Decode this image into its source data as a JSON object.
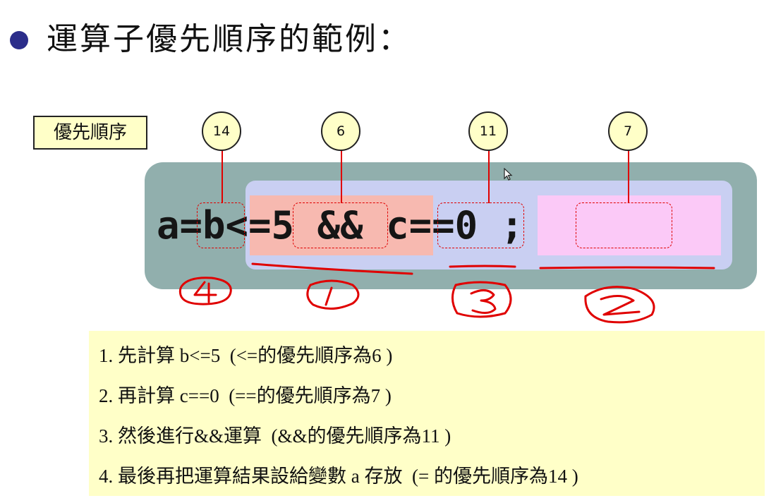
{
  "slide": {
    "title": "運算子優先順序的範例："
  },
  "legend": {
    "label": "優先順序"
  },
  "precedence_markers": [
    {
      "value": "14",
      "operator": "="
    },
    {
      "value": "6",
      "operator": "<="
    },
    {
      "value": "11",
      "operator": "&&"
    },
    {
      "value": "7",
      "operator": "=="
    }
  ],
  "expression": {
    "text": "a=b<=5 && c==0 ;"
  },
  "handwritten_order": [
    "4",
    "1",
    "3",
    "2"
  ],
  "explanation": {
    "line1": "1. 先計算 b<=5  (<=的優先順序為6 )",
    "line2": "2. 再計算 c==0  (==的優先順序為7 )",
    "line3": "3. 然後進行&&運算  (&&的優先順序為11 )",
    "line4": "4. 最後再把運算結果設給變數 a 存放  (= 的優先順序為14 )"
  },
  "colors": {
    "outer_panel": "#91afad",
    "inner_panel": "#c9cff2",
    "pink_highlight": "#f7b9b0",
    "magenta_highlight": "#fbc9f7",
    "note_background": "#ffffc8",
    "annotation_red": "#e00000",
    "bullet": "#2b2d8a"
  },
  "icons": [
    "bullet-icon",
    "mouse-cursor-icon"
  ]
}
